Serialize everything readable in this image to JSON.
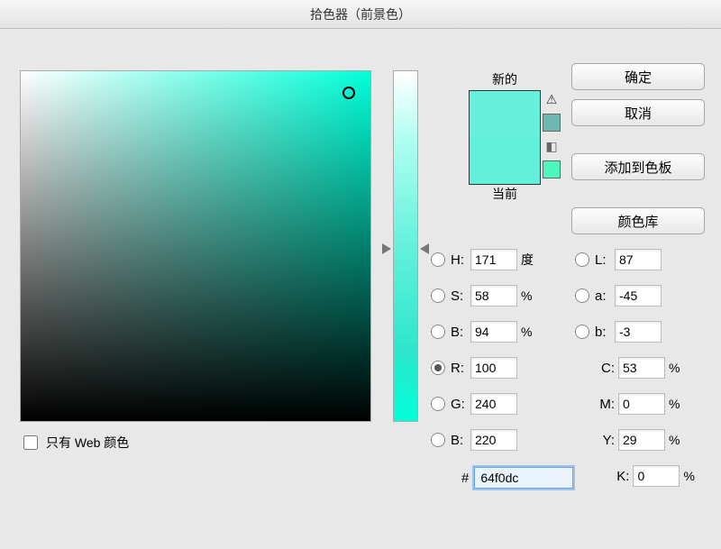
{
  "title": "拾色器（前景色）",
  "preview": {
    "new_label": "新的",
    "current_label": "当前",
    "new_color": "#64f0dc",
    "current_color": "#60f0db"
  },
  "buttons": {
    "ok": "确定",
    "cancel": "取消",
    "add_swatch": "添加到色板",
    "color_lib": "颜色库"
  },
  "fields": {
    "H": {
      "label": "H:",
      "value": "171",
      "unit": "度"
    },
    "S": {
      "label": "S:",
      "value": "58",
      "unit": "%"
    },
    "Bv": {
      "label": "B:",
      "value": "94",
      "unit": "%"
    },
    "R": {
      "label": "R:",
      "value": "100",
      "unit": ""
    },
    "G": {
      "label": "G:",
      "value": "240",
      "unit": ""
    },
    "Bb": {
      "label": "B:",
      "value": "220",
      "unit": ""
    },
    "L": {
      "label": "L:",
      "value": "87"
    },
    "a": {
      "label": "a:",
      "value": "-45"
    },
    "b": {
      "label": "b:",
      "value": "-3"
    },
    "C": {
      "label": "C:",
      "value": "53",
      "unit": "%"
    },
    "M": {
      "label": "M:",
      "value": "0",
      "unit": "%"
    },
    "Y": {
      "label": "Y:",
      "value": "29",
      "unit": "%"
    },
    "K": {
      "label": "K:",
      "value": "0",
      "unit": "%"
    }
  },
  "hex": {
    "label": "#",
    "value": "64f0dc"
  },
  "webonly_label": "只有 Web 颜色",
  "selected_radio": "R"
}
